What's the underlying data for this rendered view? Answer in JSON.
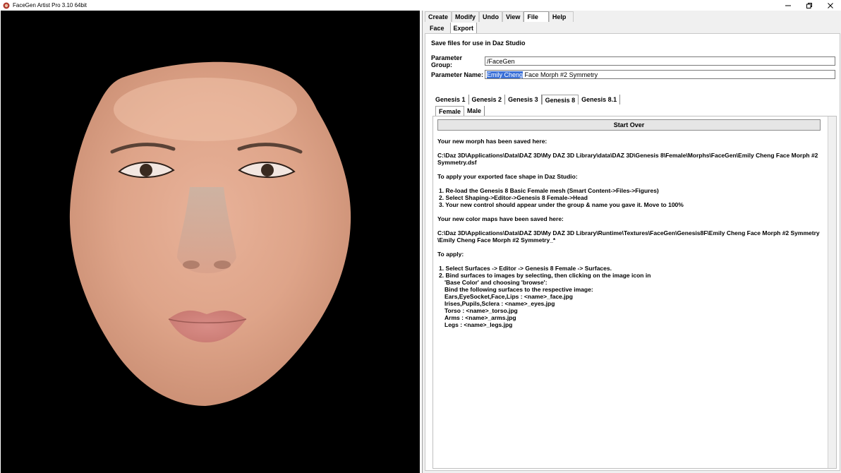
{
  "window": {
    "title": "FaceGen Artist Pro 3.10 64bit",
    "controls": [
      "minimize-icon",
      "restore-icon",
      "close-icon"
    ]
  },
  "menu": {
    "tabs": [
      "Create",
      "Modify",
      "Undo",
      "View",
      "File",
      "Help"
    ],
    "active": "File"
  },
  "file_menu": {
    "subtabs": [
      "Face",
      "Export"
    ],
    "active": "Export"
  },
  "export": {
    "heading": "Save files for use in Daz Studio",
    "param_group_label": "Parameter Group:",
    "param_group_value": "/FaceGen",
    "param_name_label": "Parameter Name:",
    "param_name_selected": "Emily Cheng",
    "param_name_rest": " Face Morph #2 Symmetry",
    "genesis_tabs": [
      "Genesis 1",
      "Genesis 2",
      "Genesis 3",
      "Genesis 8",
      "Genesis 8.1"
    ],
    "genesis_active": "Genesis 8",
    "gender_tabs": [
      "Female",
      "Male"
    ],
    "gender_active": "Female",
    "start_over_label": "Start Over",
    "lines": [
      "Your new morph has been saved here:",
      "",
      "C:\\Daz 3D\\Applications\\Data\\DAZ 3D\\My DAZ 3D Library\\data\\DAZ 3D\\Genesis 8\\Female\\Morphs\\FaceGen\\Emily Cheng Face Morph #2",
      "Symmetry.dsf",
      "",
      "To apply your exported face shape in Daz Studio:",
      "",
      "  1. Re-load the Genesis 8 Basic Female mesh (Smart Content->Files->Figures)",
      "  2. Select Shaping->Editor->Genesis 8 Female->Head",
      "  3. Your new control should appear under the group & name you gave it. Move to 100%",
      "",
      "Your new color maps have been saved here:",
      "",
      "C:\\Daz 3D\\Applications\\Data\\DAZ 3D\\My DAZ 3D Library\\Runtime\\Textures\\FaceGen\\Genesis8F\\Emily Cheng Face Morph #2 Symmetry",
      "\\Emily Cheng Face Morph #2 Symmetry_*",
      "",
      "To apply:",
      "",
      "  1. Select Surfaces -> Editor -> Genesis 8 Female -> Surfaces.",
      "  2. Bind surfaces to images by selecting, then clicking on the image icon in",
      "      'Base Color' and choosing 'browse':",
      "      Bind the following surfaces to the respective image:",
      "      Ears,EyeSocket,Face,Lips : <name>_face.jpg",
      "      Irises,Pupils,Sclera : <name>_eyes.jpg",
      "      Torso : <name>_torso.jpg",
      "      Arms : <name>_arms.jpg",
      "      Legs : <name>_legs.jpg"
    ]
  }
}
